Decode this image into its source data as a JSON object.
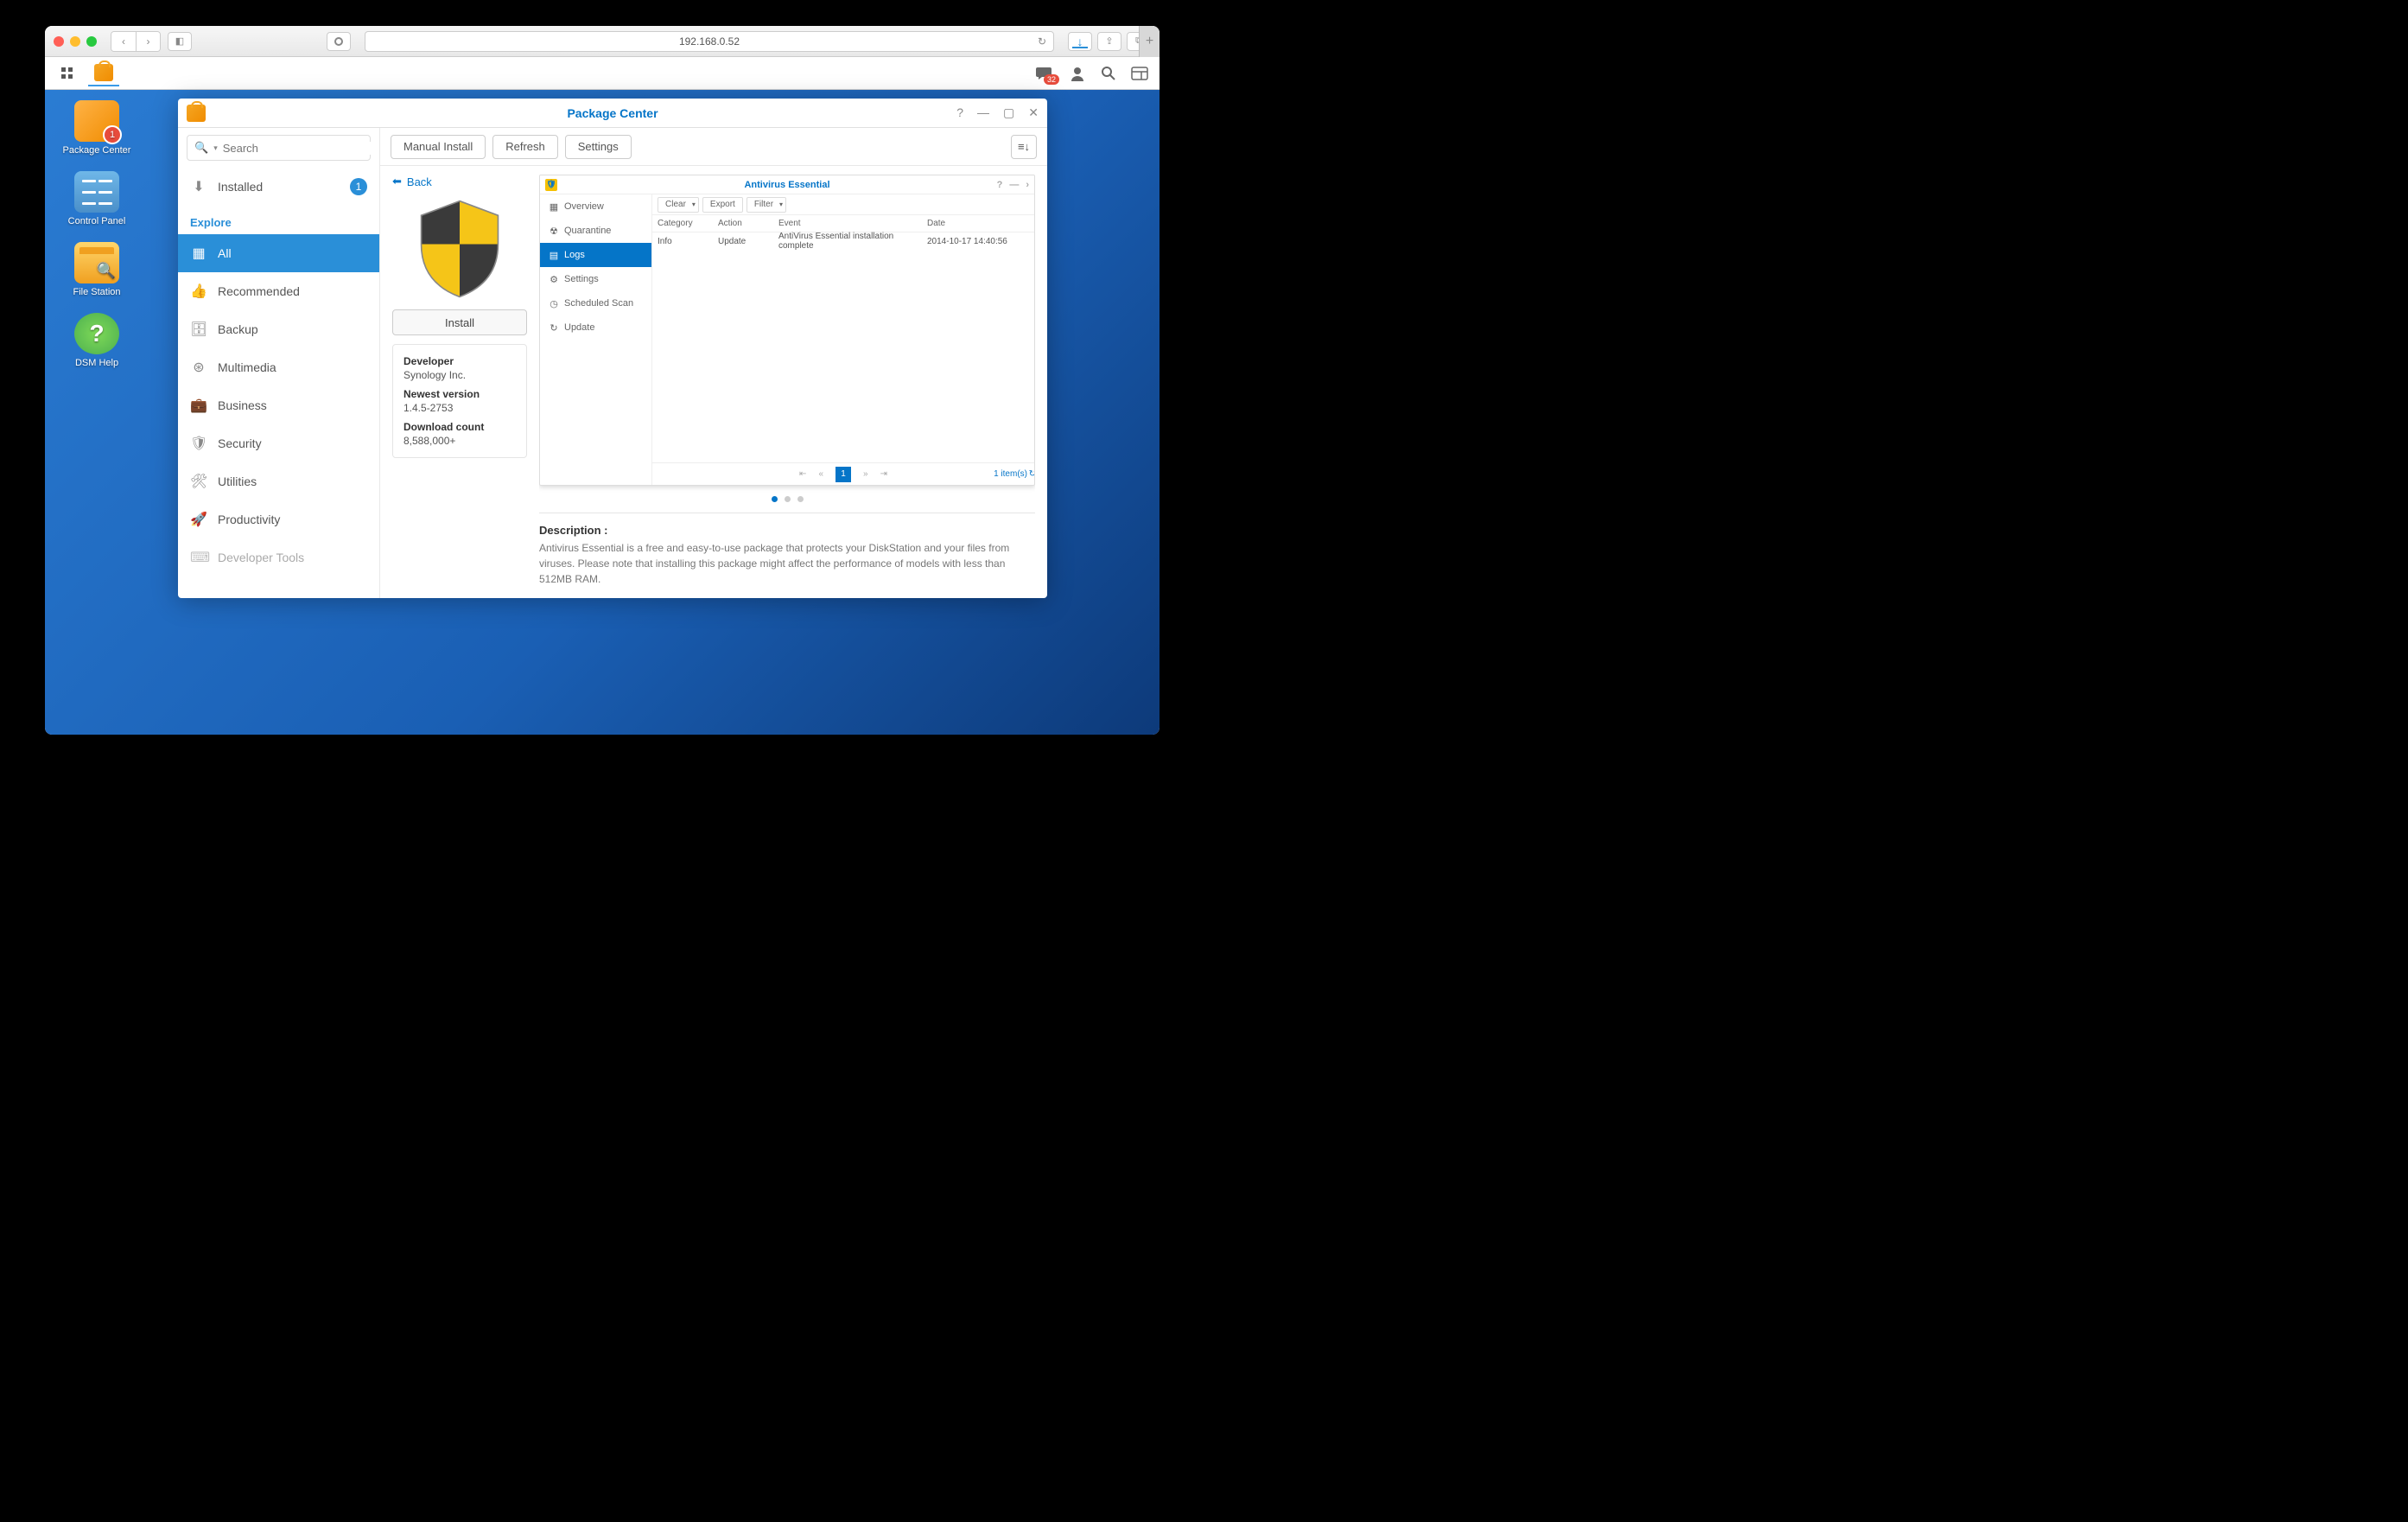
{
  "browser": {
    "url": "192.168.0.52"
  },
  "taskbar": {
    "notif_count": "32"
  },
  "desktop_icons": [
    {
      "label": "Package Center",
      "badge": "1"
    },
    {
      "label": "Control Panel"
    },
    {
      "label": "File Station"
    },
    {
      "label": "DSM Help"
    }
  ],
  "window": {
    "title": "Package Center",
    "search_placeholder": "Search",
    "toolbar": {
      "manual_install": "Manual Install",
      "refresh": "Refresh",
      "settings": "Settings"
    },
    "sidebar": {
      "installed": {
        "label": "Installed",
        "badge": "1"
      },
      "explore_heading": "Explore",
      "categories": [
        "All",
        "Recommended",
        "Backup",
        "Multimedia",
        "Business",
        "Security",
        "Utilities",
        "Productivity",
        "Developer Tools"
      ]
    },
    "detail": {
      "back": "Back",
      "install": "Install",
      "meta": {
        "developer_label": "Developer",
        "developer": "Synology Inc.",
        "version_label": "Newest version",
        "version": "1.4.5-2753",
        "downloads_label": "Download count",
        "downloads": "8,588,000+"
      },
      "screenshot": {
        "title": "Antivirus Essential",
        "nav": [
          "Overview",
          "Quarantine",
          "Logs",
          "Settings",
          "Scheduled Scan",
          "Update"
        ],
        "tools": {
          "clear": "Clear",
          "export": "Export",
          "filter": "Filter"
        },
        "columns": [
          "Category",
          "Action",
          "Event",
          "Date"
        ],
        "row": {
          "category": "Info",
          "action": "Update",
          "event": "AntiVirus Essential installation complete",
          "date": "2014-10-17 14:40:56"
        },
        "page": "1",
        "items": "1 item(s)"
      },
      "description_heading": "Description :",
      "description": "Antivirus Essential is a free and easy-to-use package that protects your DiskStation and your files from viruses. Please note that installing this package might affect the performance of models with less than 512MB RAM."
    }
  }
}
